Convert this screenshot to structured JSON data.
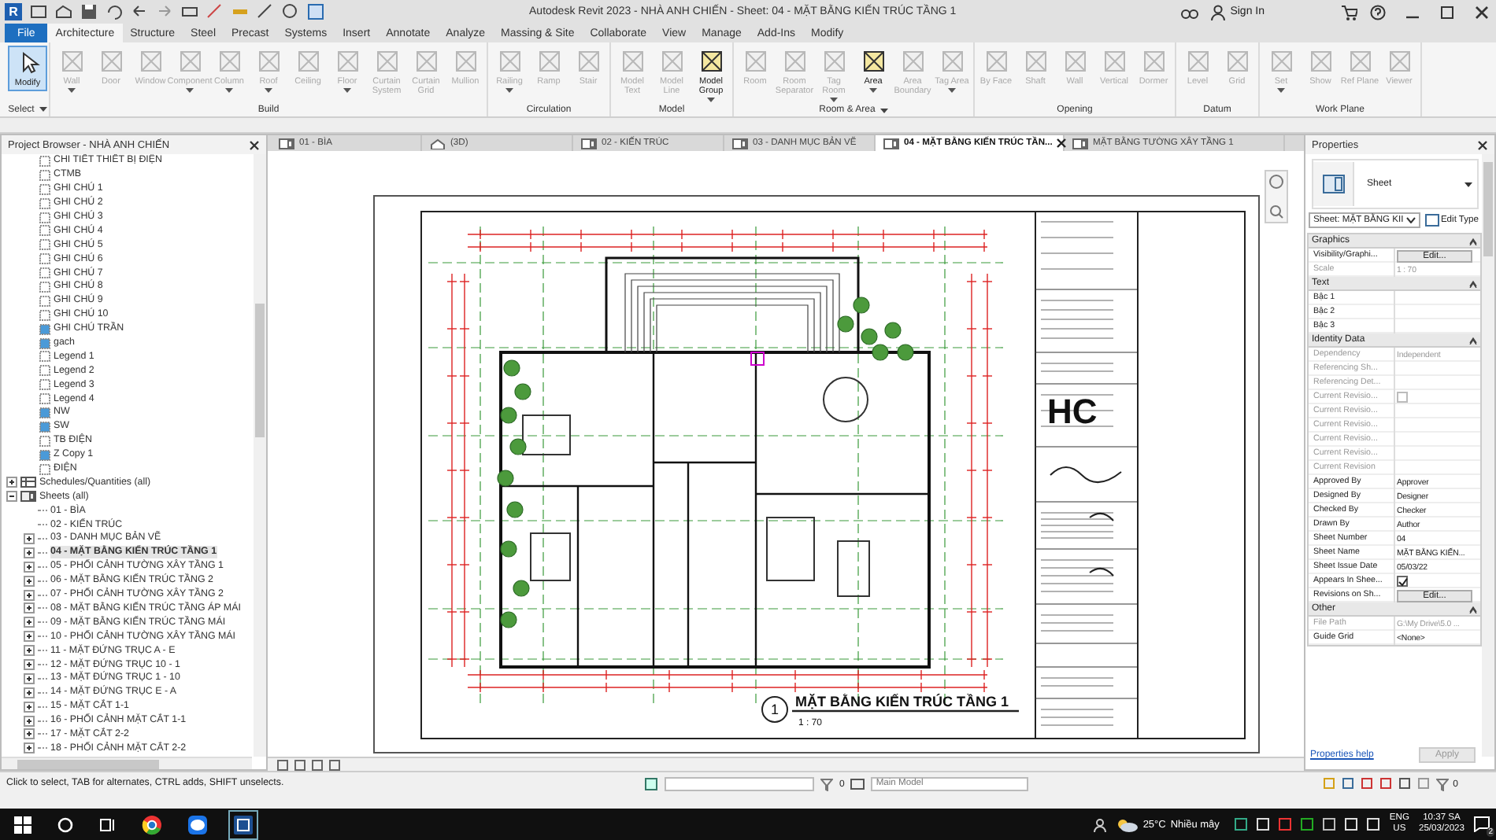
{
  "window": {
    "app_logo": "R",
    "title": "Autodesk Revit 2023 - NHÀ ANH CHIẾN - Sheet: 04 - MẶT BẰNG KIẾN TRÚC TẦNG 1",
    "sign_in": "Sign In"
  },
  "ribbon_tabs": [
    {
      "label": "File",
      "kind": "application",
      "selected": false
    },
    {
      "label": "Architecture",
      "kind": "tab",
      "selected": true
    },
    {
      "label": "Structure",
      "kind": "tab",
      "selected": false
    },
    {
      "label": "Steel",
      "kind": "tab",
      "selected": false
    },
    {
      "label": "Precast",
      "kind": "tab",
      "selected": false
    },
    {
      "label": "Systems",
      "kind": "tab",
      "selected": false
    },
    {
      "label": "Insert",
      "kind": "tab",
      "selected": false
    },
    {
      "label": "Annotate",
      "kind": "tab",
      "selected": false
    },
    {
      "label": "Analyze",
      "kind": "tab",
      "selected": false
    },
    {
      "label": "Massing & Site",
      "kind": "tab",
      "selected": false
    },
    {
      "label": "Collaborate",
      "kind": "tab",
      "selected": false
    },
    {
      "label": "View",
      "kind": "tab",
      "selected": false
    },
    {
      "label": "Manage",
      "kind": "tab",
      "selected": false
    },
    {
      "label": "Add-Ins",
      "kind": "tab",
      "selected": false
    },
    {
      "label": "Modify",
      "kind": "tab",
      "selected": false
    }
  ],
  "ribbon_panels": [
    {
      "title": "Select",
      "menu": true,
      "tools": [
        {
          "label": "Modify",
          "disabled": false,
          "selected": true,
          "dropdown": false
        }
      ]
    },
    {
      "title": "Build",
      "menu": false,
      "tools": [
        {
          "label": "Wall",
          "disabled": true,
          "selected": false,
          "dropdown": true
        },
        {
          "label": "Door",
          "disabled": true,
          "selected": false,
          "dropdown": false
        },
        {
          "label": "Window",
          "disabled": true,
          "selected": false,
          "dropdown": false
        },
        {
          "label": "Component",
          "disabled": true,
          "selected": false,
          "dropdown": true
        },
        {
          "label": "Column",
          "disabled": true,
          "selected": false,
          "dropdown": true
        },
        {
          "label": "Roof",
          "disabled": true,
          "selected": false,
          "dropdown": true
        },
        {
          "label": "Ceiling",
          "disabled": true,
          "selected": false,
          "dropdown": false
        },
        {
          "label": "Floor",
          "disabled": true,
          "selected": false,
          "dropdown": true
        },
        {
          "label": "Curtain System",
          "disabled": true,
          "selected": false,
          "dropdown": false
        },
        {
          "label": "Curtain Grid",
          "disabled": true,
          "selected": false,
          "dropdown": false
        },
        {
          "label": "Mullion",
          "disabled": true,
          "selected": false,
          "dropdown": false
        }
      ]
    },
    {
      "title": "Circulation",
      "menu": false,
      "tools": [
        {
          "label": "Railing",
          "disabled": true,
          "selected": false,
          "dropdown": true
        },
        {
          "label": "Ramp",
          "disabled": true,
          "selected": false,
          "dropdown": false
        },
        {
          "label": "Stair",
          "disabled": true,
          "selected": false,
          "dropdown": false
        }
      ]
    },
    {
      "title": "Model",
      "menu": false,
      "tools": [
        {
          "label": "Model Text",
          "disabled": true,
          "selected": false,
          "dropdown": false
        },
        {
          "label": "Model Line",
          "disabled": true,
          "selected": false,
          "dropdown": false
        },
        {
          "label": "Model Group",
          "disabled": false,
          "selected": false,
          "dropdown": true
        }
      ]
    },
    {
      "title": "Room & Area",
      "menu": true,
      "tools": [
        {
          "label": "Room",
          "disabled": true,
          "selected": false,
          "dropdown": false
        },
        {
          "label": "Room Separator",
          "disabled": true,
          "selected": false,
          "dropdown": false
        },
        {
          "label": "Tag Room",
          "disabled": true,
          "selected": false,
          "dropdown": true
        },
        {
          "label": "Area",
          "disabled": false,
          "selected": false,
          "dropdown": true
        },
        {
          "label": "Area Boundary",
          "disabled": true,
          "selected": false,
          "dropdown": false
        },
        {
          "label": "Tag Area",
          "disabled": true,
          "selected": false,
          "dropdown": true
        }
      ]
    },
    {
      "title": "Opening",
      "menu": false,
      "tools": [
        {
          "label": "By Face",
          "disabled": true,
          "selected": false,
          "dropdown": false
        },
        {
          "label": "Shaft",
          "disabled": true,
          "selected": false,
          "dropdown": false
        },
        {
          "label": "Wall",
          "disabled": true,
          "selected": false,
          "dropdown": false
        },
        {
          "label": "Vertical",
          "disabled": true,
          "selected": false,
          "dropdown": false
        },
        {
          "label": "Dormer",
          "disabled": true,
          "selected": false,
          "dropdown": false
        }
      ]
    },
    {
      "title": "Datum",
      "menu": false,
      "tools": [
        {
          "label": "Level",
          "disabled": true,
          "selected": false,
          "dropdown": false
        },
        {
          "label": "Grid",
          "disabled": true,
          "selected": false,
          "dropdown": false
        }
      ]
    },
    {
      "title": "Work Plane",
      "menu": false,
      "tools": [
        {
          "label": "Set",
          "disabled": true,
          "selected": false,
          "dropdown": true
        },
        {
          "label": "Show",
          "disabled": true,
          "selected": false,
          "dropdown": false
        },
        {
          "label": "Ref Plane",
          "disabled": true,
          "selected": false,
          "dropdown": false
        },
        {
          "label": "Viewer",
          "disabled": true,
          "selected": false,
          "dropdown": false
        }
      ]
    }
  ],
  "project_browser": {
    "title": "Project Browser - NHÀ ANH CHIẾN",
    "items": [
      {
        "label": "CHI TIẾT THIẾT BỊ ĐIỆN",
        "kind": "view",
        "filled": false
      },
      {
        "label": "CTMB",
        "kind": "view",
        "filled": false
      },
      {
        "label": "GHI CHÚ 1",
        "kind": "view",
        "filled": false
      },
      {
        "label": "GHI CHÚ 2",
        "kind": "view",
        "filled": false
      },
      {
        "label": "GHI CHÚ 3",
        "kind": "view",
        "filled": false
      },
      {
        "label": "GHI CHÚ 4",
        "kind": "view",
        "filled": false
      },
      {
        "label": "GHI CHÚ 5",
        "kind": "view",
        "filled": false
      },
      {
        "label": "GHI CHÚ 6",
        "kind": "view",
        "filled": false
      },
      {
        "label": "GHI CHÚ 7",
        "kind": "view",
        "filled": false
      },
      {
        "label": "GHI CHÚ 8",
        "kind": "view",
        "filled": false
      },
      {
        "label": "GHI CHÚ 9",
        "kind": "view",
        "filled": false
      },
      {
        "label": "GHI CHÚ 10",
        "kind": "view",
        "filled": false
      },
      {
        "label": "GHI CHÚ TRẦN",
        "kind": "view",
        "filled": true
      },
      {
        "label": "gach",
        "kind": "view",
        "filled": true
      },
      {
        "label": "Legend 1",
        "kind": "view",
        "filled": false
      },
      {
        "label": "Legend 2",
        "kind": "view",
        "filled": false
      },
      {
        "label": "Legend 3",
        "kind": "view",
        "filled": false
      },
      {
        "label": "Legend 4",
        "kind": "view",
        "filled": false
      },
      {
        "label": "NW",
        "kind": "view",
        "filled": true
      },
      {
        "label": "SW",
        "kind": "view",
        "filled": true
      },
      {
        "label": "TB ĐIỆN",
        "kind": "view",
        "filled": false
      },
      {
        "label": "Z Copy 1",
        "kind": "view",
        "filled": true
      },
      {
        "label": "ĐIỆN",
        "kind": "view",
        "filled": false
      },
      {
        "label": "Schedules/Quantities (all)",
        "kind": "schedules",
        "expanded": false
      },
      {
        "label": "Sheets (all)",
        "kind": "sheets",
        "expanded": true,
        "children": [
          {
            "label": "01 - BÌA",
            "expandable": false,
            "selected": false
          },
          {
            "label": "02 - KIẾN TRÚC",
            "expandable": false,
            "selected": false
          },
          {
            "label": "03 - DANH MỤC BẢN VẼ",
            "expandable": true,
            "selected": false
          },
          {
            "label": "04 - MẶT BẰNG KIẾN TRÚC TẦNG 1",
            "expandable": true,
            "selected": true
          },
          {
            "label": "05 - PHỐI CẢNH TƯỜNG XÂY TẦNG 1",
            "expandable": true,
            "selected": false
          },
          {
            "label": "06 - MẶT BẰNG KIẾN TRÚC TẦNG 2",
            "expandable": true,
            "selected": false
          },
          {
            "label": "07 - PHỐI CẢNH TƯỜNG XÂY TẦNG 2",
            "expandable": true,
            "selected": false
          },
          {
            "label": "08 - MẶT BẰNG KIẾN TRÚC TẦNG ÁP MÁI",
            "expandable": true,
            "selected": false
          },
          {
            "label": "09 - MẶT BẰNG KIẾN TRÚC TẦNG MÁI",
            "expandable": true,
            "selected": false
          },
          {
            "label": "10 - PHỐI CẢNH TƯỜNG XÂY TẦNG MÁI",
            "expandable": true,
            "selected": false
          },
          {
            "label": "11 - MẶT ĐỨNG TRỤC A - E",
            "expandable": true,
            "selected": false
          },
          {
            "label": "12 - MẶT ĐỨNG TRỤC 10 - 1",
            "expandable": true,
            "selected": false
          },
          {
            "label": "13 - MẶT ĐỨNG TRỤC 1 - 10",
            "expandable": true,
            "selected": false
          },
          {
            "label": "14 - MẶT ĐỨNG TRỤC E - A",
            "expandable": true,
            "selected": false
          },
          {
            "label": "15 - MẶT CẮT 1-1",
            "expandable": true,
            "selected": false
          },
          {
            "label": "16 - PHỐI CẢNH MẶT CẮT 1-1",
            "expandable": true,
            "selected": false
          },
          {
            "label": "17 - MẶT CẮT 2-2",
            "expandable": true,
            "selected": false
          },
          {
            "label": "18 - PHỐI CẢNH MẶT CẮT 2-2",
            "expandable": true,
            "selected": false
          }
        ]
      }
    ]
  },
  "view_tabs": [
    {
      "label": "01 - BÌA",
      "kind": "sheet",
      "selected": false
    },
    {
      "label": "(3D)",
      "kind": "model",
      "selected": false
    },
    {
      "label": "02 - KIẾN TRÚC",
      "kind": "sheet",
      "selected": false
    },
    {
      "label": "03 - DANH MỤC BẢN VẼ",
      "kind": "sheet",
      "selected": false
    },
    {
      "label": "04 - MẶT BẰNG KIẾN TRÚC TẦN...",
      "kind": "sheet",
      "selected": true
    },
    {
      "label": "MẶT BẰNG TƯỜNG XÂY TẦNG 1",
      "kind": "sheet",
      "selected": false
    }
  ],
  "sheet": {
    "view_title": "MẶT BẰNG KIẾN TRÚC TẦNG 1",
    "view_number": "1",
    "view_scale": "1 : 70",
    "logo_text": "HC"
  },
  "properties": {
    "title": "Properties",
    "type_name": "Sheet",
    "selector": "Sheet: MẶT BẰNG KII",
    "edit_type": "Edit Type",
    "groups": [
      {
        "title": "Graphics",
        "rows": [
          {
            "name": "Visibility/Graphi...",
            "kind": "button",
            "value": "Edit...",
            "disabled": false
          },
          {
            "name": "Scale",
            "kind": "text",
            "value": "1 : 70",
            "disabled": true
          }
        ]
      },
      {
        "title": "Text",
        "rows": [
          {
            "name": "Bậc 1",
            "kind": "text",
            "disabled": false
          },
          {
            "name": "Bậc 2",
            "kind": "text",
            "disabled": false
          },
          {
            "name": "Bậc 3",
            "kind": "text",
            "disabled": false
          }
        ]
      },
      {
        "title": "Identity Data",
        "rows": [
          {
            "name": "Dependency",
            "kind": "text",
            "value": "Independent",
            "disabled": true
          },
          {
            "name": "Referencing Sh...",
            "kind": "text",
            "disabled": true
          },
          {
            "name": "Referencing Det...",
            "kind": "text",
            "disabled": true
          },
          {
            "name": "Current Revisio...",
            "kind": "checkbox",
            "checked": false,
            "disabled": true
          },
          {
            "name": "Current Revisio...",
            "kind": "text",
            "disabled": true
          },
          {
            "name": "Current Revisio...",
            "kind": "text",
            "disabled": true
          },
          {
            "name": "Current Revisio...",
            "kind": "text",
            "disabled": true
          },
          {
            "name": "Current Revisio...",
            "kind": "text",
            "disabled": true
          },
          {
            "name": "Current Revision",
            "kind": "text",
            "disabled": true
          },
          {
            "name": "Approved By",
            "kind": "text",
            "value": "Approver",
            "disabled": false
          },
          {
            "name": "Designed By",
            "kind": "text",
            "value": "Designer",
            "disabled": false
          },
          {
            "name": "Checked By",
            "kind": "text",
            "value": "Checker",
            "disabled": false
          },
          {
            "name": "Drawn By",
            "kind": "text",
            "value": "Author",
            "disabled": false
          },
          {
            "name": "Sheet Number",
            "kind": "text",
            "value": "04",
            "disabled": false
          },
          {
            "name": "Sheet Name",
            "kind": "text",
            "value": "MẶT BẰNG KIẾN...",
            "disabled": false
          },
          {
            "name": "Sheet Issue Date",
            "kind": "text",
            "value": "05/03/22",
            "disabled": false
          },
          {
            "name": "Appears In Shee...",
            "kind": "checkbox",
            "checked": true,
            "disabled": false
          },
          {
            "name": "Revisions on Sh...",
            "kind": "button",
            "value": "Edit...",
            "disabled": false
          }
        ]
      },
      {
        "title": "Other",
        "rows": [
          {
            "name": "File Path",
            "kind": "text",
            "value": "G:\\My Drive\\5.0 ...",
            "disabled": true
          },
          {
            "name": "Guide Grid",
            "kind": "text",
            "value": "<None>",
            "disabled": false
          }
        ]
      }
    ],
    "help_link": "Properties help",
    "apply": "Apply"
  },
  "status_bar": {
    "message": "Click to select, TAB for alternates, CTRL adds, SHIFT unselects.",
    "editable_count": "0",
    "model": "Main Model",
    "filter_count": "0"
  },
  "taskbar": {
    "temperature": "25°C",
    "weather": "Nhiều mây",
    "language": "ENG",
    "region": "US",
    "time": "10:37 SA",
    "date": "25/03/2023",
    "notifications": "2"
  }
}
